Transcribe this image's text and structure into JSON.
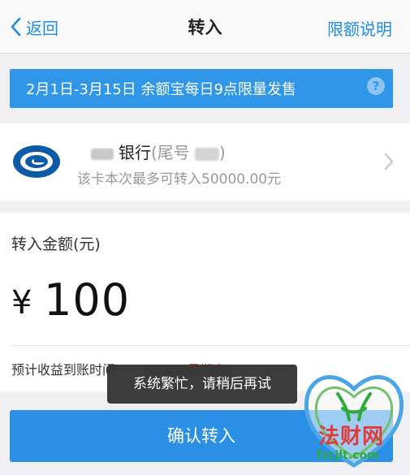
{
  "nav": {
    "back_label": "返回",
    "title": "转入",
    "right_label": "限额说明"
  },
  "banner": {
    "text": "2月1日-3月15日 余额宝每日9点限量发售",
    "help_glyph": "?"
  },
  "card": {
    "bank_name": "银行",
    "tail_label": "(尾号",
    "tail_close": ")",
    "limit_text": "该卡本次最多可转入50000.00元"
  },
  "amount": {
    "label": "转入金额(元)",
    "currency": "¥",
    "value": "100",
    "eta_label": "预计收益到账时间",
    "eta_value": "02-04(星期六)"
  },
  "toast": {
    "text": "系统繁忙，请稍后再试"
  },
  "confirm": {
    "label": "确认转入"
  },
  "watermark": {
    "title": "法财网",
    "url": "fzcjlt.com"
  },
  "colors": {
    "accent": "#1e8be6",
    "banner": "#2f96e8",
    "button": "#2b8fe5",
    "eta": "#e55a4c"
  }
}
